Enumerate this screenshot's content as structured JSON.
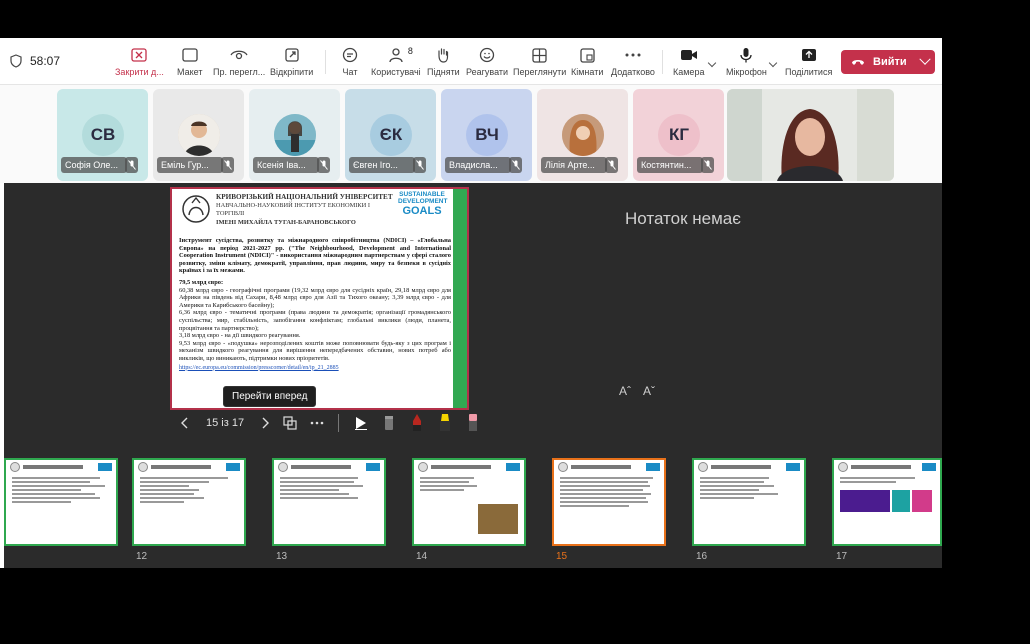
{
  "toolbar": {
    "timer": "58:07",
    "close_label": "Закрити д...",
    "layout_label": "Макет",
    "view_label": "Пр. перегл...",
    "popout_label": "Відкріпити",
    "chat_label": "Чат",
    "people_label": "Користувачі",
    "people_count": "8",
    "raise_label": "Підняти",
    "react_label": "Реагувати",
    "view2_label": "Переглянути",
    "rooms_label": "Кімнати",
    "more_label": "Додатково",
    "camera_label": "Камера",
    "mic_label": "Мікрофон",
    "share_label": "Поділитися",
    "leave_label": "Вийти"
  },
  "participants": [
    {
      "initials": "СВ",
      "name": "Софія Оле...",
      "color": "#c8e8e8"
    },
    {
      "initials": "",
      "name": "Еміль Гур...",
      "color": "#e9e9e9"
    },
    {
      "initials": "",
      "name": "Ксенія Іва...",
      "color": "#e6eef0"
    },
    {
      "initials": "ЄК",
      "name": "Євген Іго...",
      "color": "#c7dde8"
    },
    {
      "initials": "ВЧ",
      "name": "Владисла...",
      "color": "#c9d5ef"
    },
    {
      "initials": "",
      "name": "Лілія Арте...",
      "color": "#efe4e4"
    },
    {
      "initials": "КГ",
      "name": "Костянтин...",
      "color": "#f2d2d8"
    }
  ],
  "slide": {
    "uni_line1": "КРИВОРІЗЬКИЙ НАЦІОНАЛЬНИЙ УНІВЕРСИТЕТ",
    "uni_line2": "НАВЧАЛЬНО-НАУКОВИЙ ІНСТИТУТ ЕКОНОМІКИ І ТОРГІВЛІ",
    "uni_line3": "ІМЕНІ МИХАЙЛА ТУГАН-БАРАНОВСЬКОГО",
    "sdg_line1": "SUSTAINABLE",
    "sdg_line2": "DEVELOPMENT",
    "sdg_line3": "GOALS",
    "p1": "Інструмент сусідства, розвитку та міжнародного співробітництва (NDICI) – «Глобальна Європа» на період 2021-2027 рр. (\"The Neighbourhood, Development and International Cooperation Instrument (NDICI)\" - використання міжнародним партнерствам у сфері сталого розвитку, зміни клімату, демократії, управління, прав людини, миру та безпеки в сусідніх країнах і за їх межами.",
    "p2": "79,5 млрд євро:",
    "p3": "60,38 млрд євро - географічні програми (19,32 млрд євро для сусідніх країн, 29,18 млрд євро для Африки на південь від Сахари, 8,48 млрд євро для Азії та Тихого океану; 3,39 млрд євро - для Америки та Карибського басейну);",
    "p4": "6,36 млрд євро - тематичні програми (права людини та демократія; організації громадянського суспільства; мир, стабільність, запобігання конфліктам; глобальні виклики (люди, планета, процвітання та партнерство);",
    "p5": "3,18 млрд євро - на дії швидкого реагування.",
    "p6": "9,53 млрд євро - «подушка» нерозподілених коштів може поповнювати будь-яку з цих програм і механізм швидкого реагування для вирішення непередбачених обставин, нових потреб або викликів, що виникають, підтримки нових пріоритетів.",
    "link": "https://ec.europa.eu/commission/presscorner/detail/en/ip_21_2885"
  },
  "stage": {
    "notes": "Нотаток немає",
    "font_down": "Aˆ",
    "font_up": "Aˇ",
    "tooltip": "Перейти вперед",
    "counter": "15 із 17"
  },
  "thumbs": [
    {
      "num": ""
    },
    {
      "num": "12"
    },
    {
      "num": "13"
    },
    {
      "num": "14"
    },
    {
      "num": "15"
    },
    {
      "num": "16"
    },
    {
      "num": "17"
    }
  ],
  "colors": {
    "leave": "#c4314b",
    "active_thumb": "#e8711a",
    "slide_green": "#32a852"
  }
}
